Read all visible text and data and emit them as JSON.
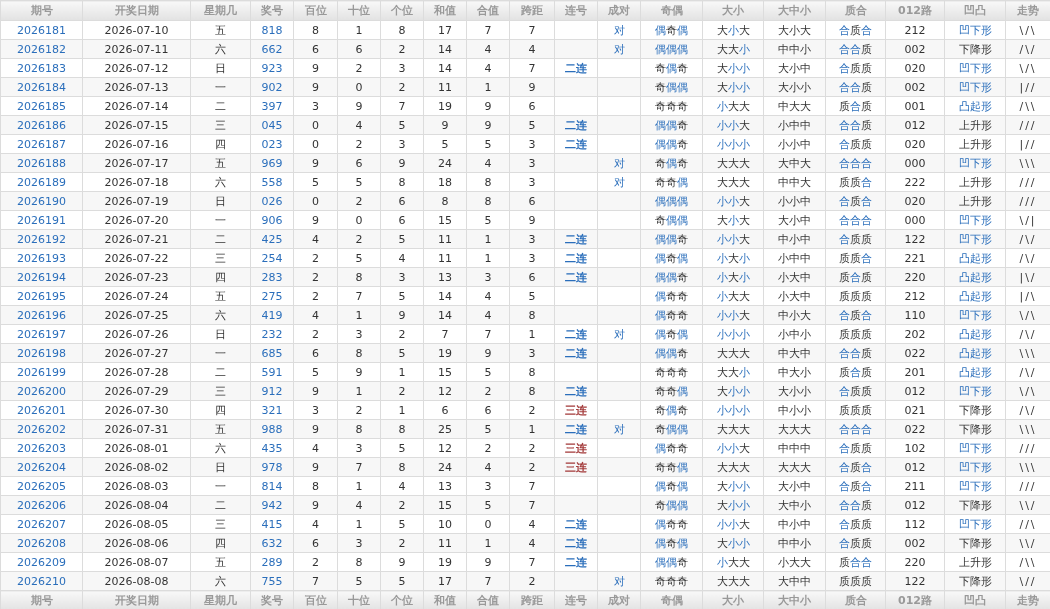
{
  "header": [
    "期号",
    "开奖日期",
    "星期几",
    "奖号",
    "百位",
    "十位",
    "个位",
    "和值",
    "合值",
    "跨距",
    "连号",
    "成对",
    "奇偶",
    "大小",
    "大中小",
    "质合",
    "012路",
    "凹凸",
    "走势"
  ],
  "rows": [
    {
      "issue": "2026181",
      "date": "2026-07-10",
      "weekday": "五",
      "number": "818",
      "hundreds": "8",
      "tens": "1",
      "units": "8",
      "sum": "17",
      "sum_tail": "7",
      "span": "7",
      "pair": "对",
      "parity": "偶奇偶",
      "parity_hl": [
        true,
        false,
        true
      ],
      "size": "大小大",
      "size_hl": [
        false,
        true,
        false
      ],
      "size3": "大小大",
      "prime": "合质合",
      "prime_hl": [
        true,
        false,
        true
      ],
      "route": "212",
      "shape": "凹下形",
      "shape_hl": true,
      "trend": "\\/\\"
    },
    {
      "issue": "2026182",
      "date": "2026-07-11",
      "weekday": "六",
      "number": "662",
      "hundreds": "6",
      "tens": "6",
      "units": "2",
      "sum": "14",
      "sum_tail": "4",
      "span": "4",
      "pair": "对",
      "parity": "偶偶偶",
      "parity_hl": [
        true,
        true,
        true
      ],
      "size": "大大小",
      "size_hl": [
        false,
        false,
        true
      ],
      "size3": "中中小",
      "prime": "合合质",
      "prime_hl": [
        true,
        true,
        false
      ],
      "route": "002",
      "shape": "下降形",
      "shape_hl": false,
      "trend": "/\\/"
    },
    {
      "issue": "2026183",
      "date": "2026-07-12",
      "weekday": "日",
      "number": "923",
      "hundreds": "9",
      "tens": "2",
      "units": "3",
      "sum": "14",
      "sum_tail": "4",
      "span": "7",
      "consec": {
        "text": "二连",
        "color": "#2a6ebb"
      },
      "parity": "奇偶奇",
      "parity_hl": [
        false,
        true,
        false
      ],
      "size": "大小小",
      "size_hl": [
        false,
        true,
        true
      ],
      "size3": "大小中",
      "prime": "合质质",
      "prime_hl": [
        true,
        false,
        false
      ],
      "route": "020",
      "shape": "凹下形",
      "shape_hl": true,
      "trend": "\\/\\"
    },
    {
      "issue": "2026184",
      "date": "2026-07-13",
      "weekday": "一",
      "number": "902",
      "hundreds": "9",
      "tens": "0",
      "units": "2",
      "sum": "11",
      "sum_tail": "1",
      "span": "9",
      "parity": "奇偶偶",
      "parity_hl": [
        false,
        true,
        true
      ],
      "size": "大小小",
      "size_hl": [
        false,
        true,
        true
      ],
      "size3": "大小小",
      "prime": "合合质",
      "prime_hl": [
        true,
        true,
        false
      ],
      "route": "002",
      "shape": "凹下形",
      "shape_hl": true,
      "trend": "|//"
    },
    {
      "issue": "2026185",
      "date": "2026-07-14",
      "weekday": "二",
      "number": "397",
      "hundreds": "3",
      "tens": "9",
      "units": "7",
      "sum": "19",
      "sum_tail": "9",
      "span": "6",
      "parity": "奇奇奇",
      "parity_hl": [
        false,
        false,
        false
      ],
      "size": "小大大",
      "size_hl": [
        true,
        false,
        false
      ],
      "size3": "中大大",
      "prime": "质合质",
      "prime_hl": [
        false,
        true,
        false
      ],
      "route": "001",
      "shape": "凸起形",
      "shape_hl": true,
      "trend": "/\\\\"
    },
    {
      "issue": "2026186",
      "date": "2026-07-15",
      "weekday": "三",
      "number": "045",
      "hundreds": "0",
      "tens": "4",
      "units": "5",
      "sum": "9",
      "sum_tail": "9",
      "span": "5",
      "consec": {
        "text": "二连",
        "color": "#2a6ebb"
      },
      "parity": "偶偶奇",
      "parity_hl": [
        true,
        true,
        false
      ],
      "size": "小小大",
      "size_hl": [
        true,
        true,
        false
      ],
      "size3": "小中中",
      "prime": "合合质",
      "prime_hl": [
        true,
        true,
        false
      ],
      "route": "012",
      "shape": "上升形",
      "shape_hl": false,
      "trend": "///"
    },
    {
      "issue": "2026187",
      "date": "2026-07-16",
      "weekday": "四",
      "number": "023",
      "hundreds": "0",
      "tens": "2",
      "units": "3",
      "sum": "5",
      "sum_tail": "5",
      "span": "3",
      "consec": {
        "text": "二连",
        "color": "#2a6ebb"
      },
      "parity": "偶偶奇",
      "parity_hl": [
        true,
        true,
        false
      ],
      "size": "小小小",
      "size_hl": [
        true,
        true,
        true
      ],
      "size3": "小小中",
      "prime": "合质质",
      "prime_hl": [
        true,
        false,
        false
      ],
      "route": "020",
      "shape": "上升形",
      "shape_hl": false,
      "trend": "|//"
    },
    {
      "issue": "2026188",
      "date": "2026-07-17",
      "weekday": "五",
      "number": "969",
      "hundreds": "9",
      "tens": "6",
      "units": "9",
      "sum": "24",
      "sum_tail": "4",
      "span": "3",
      "pair": "对",
      "parity": "奇偶奇",
      "parity_hl": [
        false,
        true,
        false
      ],
      "size": "大大大",
      "size_hl": [
        false,
        false,
        false
      ],
      "size3": "大中大",
      "prime": "合合合",
      "prime_hl": [
        true,
        true,
        true
      ],
      "route": "000",
      "shape": "凹下形",
      "shape_hl": true,
      "trend": "\\\\\\"
    },
    {
      "issue": "2026189",
      "date": "2026-07-18",
      "weekday": "六",
      "number": "558",
      "hundreds": "5",
      "tens": "5",
      "units": "8",
      "sum": "18",
      "sum_tail": "8",
      "span": "3",
      "pair": "对",
      "parity": "奇奇偶",
      "parity_hl": [
        false,
        false,
        true
      ],
      "size": "大大大",
      "size_hl": [
        false,
        false,
        false
      ],
      "size3": "中中大",
      "prime": "质质合",
      "prime_hl": [
        false,
        false,
        true
      ],
      "route": "222",
      "shape": "上升形",
      "shape_hl": false,
      "trend": "///"
    },
    {
      "issue": "2026190",
      "date": "2026-07-19",
      "weekday": "日",
      "number": "026",
      "hundreds": "0",
      "tens": "2",
      "units": "6",
      "sum": "8",
      "sum_tail": "8",
      "span": "6",
      "parity": "偶偶偶",
      "parity_hl": [
        true,
        true,
        true
      ],
      "size": "小小大",
      "size_hl": [
        true,
        true,
        false
      ],
      "size3": "小小中",
      "prime": "合质合",
      "prime_hl": [
        true,
        false,
        true
      ],
      "route": "020",
      "shape": "上升形",
      "shape_hl": false,
      "trend": "///"
    },
    {
      "issue": "2026191",
      "date": "2026-07-20",
      "weekday": "一",
      "number": "906",
      "hundreds": "9",
      "tens": "0",
      "units": "6",
      "sum": "15",
      "sum_tail": "5",
      "span": "9",
      "parity": "奇偶偶",
      "parity_hl": [
        false,
        true,
        true
      ],
      "size": "大小大",
      "size_hl": [
        false,
        true,
        false
      ],
      "size3": "大小中",
      "prime": "合合合",
      "prime_hl": [
        true,
        true,
        true
      ],
      "route": "000",
      "shape": "凹下形",
      "shape_hl": true,
      "trend": "\\/|"
    },
    {
      "issue": "2026192",
      "date": "2026-07-21",
      "weekday": "二",
      "number": "425",
      "hundreds": "4",
      "tens": "2",
      "units": "5",
      "sum": "11",
      "sum_tail": "1",
      "span": "3",
      "consec": {
        "text": "二连",
        "color": "#2a6ebb"
      },
      "parity": "偶偶奇",
      "parity_hl": [
        true,
        true,
        false
      ],
      "size": "小小大",
      "size_hl": [
        true,
        true,
        false
      ],
      "size3": "中小中",
      "prime": "合质质",
      "prime_hl": [
        true,
        false,
        false
      ],
      "route": "122",
      "shape": "凹下形",
      "shape_hl": true,
      "trend": "/\\/"
    },
    {
      "issue": "2026193",
      "date": "2026-07-22",
      "weekday": "三",
      "number": "254",
      "hundreds": "2",
      "tens": "5",
      "units": "4",
      "sum": "11",
      "sum_tail": "1",
      "span": "3",
      "consec": {
        "text": "二连",
        "color": "#2a6ebb"
      },
      "parity": "偶奇偶",
      "parity_hl": [
        true,
        false,
        true
      ],
      "size": "小大小",
      "size_hl": [
        true,
        false,
        true
      ],
      "size3": "小中中",
      "prime": "质质合",
      "prime_hl": [
        false,
        false,
        true
      ],
      "route": "221",
      "shape": "凸起形",
      "shape_hl": true,
      "trend": "/\\/"
    },
    {
      "issue": "2026194",
      "date": "2026-07-23",
      "weekday": "四",
      "number": "283",
      "hundreds": "2",
      "tens": "8",
      "units": "3",
      "sum": "13",
      "sum_tail": "3",
      "span": "6",
      "consec": {
        "text": "二连",
        "color": "#2a6ebb"
      },
      "parity": "偶偶奇",
      "parity_hl": [
        true,
        true,
        false
      ],
      "size": "小大小",
      "size_hl": [
        true,
        false,
        true
      ],
      "size3": "小大中",
      "prime": "质合质",
      "prime_hl": [
        false,
        true,
        false
      ],
      "route": "220",
      "shape": "凸起形",
      "shape_hl": true,
      "trend": "|\\/"
    },
    {
      "issue": "2026195",
      "date": "2026-07-24",
      "weekday": "五",
      "number": "275",
      "hundreds": "2",
      "tens": "7",
      "units": "5",
      "sum": "14",
      "sum_tail": "4",
      "span": "5",
      "parity": "偶奇奇",
      "parity_hl": [
        true,
        false,
        false
      ],
      "size": "小大大",
      "size_hl": [
        true,
        false,
        false
      ],
      "size3": "小大中",
      "prime": "质质质",
      "prime_hl": [
        false,
        false,
        false
      ],
      "route": "212",
      "shape": "凸起形",
      "shape_hl": true,
      "trend": "|/\\"
    },
    {
      "issue": "2026196",
      "date": "2026-07-25",
      "weekday": "六",
      "number": "419",
      "hundreds": "4",
      "tens": "1",
      "units": "9",
      "sum": "14",
      "sum_tail": "4",
      "span": "8",
      "parity": "偶奇奇",
      "parity_hl": [
        true,
        false,
        false
      ],
      "size": "小小大",
      "size_hl": [
        true,
        true,
        false
      ],
      "size3": "中小大",
      "prime": "合质合",
      "prime_hl": [
        true,
        false,
        true
      ],
      "route": "110",
      "shape": "凹下形",
      "shape_hl": true,
      "trend": "\\/\\"
    },
    {
      "issue": "2026197",
      "date": "2026-07-26",
      "weekday": "日",
      "number": "232",
      "hundreds": "2",
      "tens": "3",
      "units": "2",
      "sum": "7",
      "sum_tail": "7",
      "span": "1",
      "consec": {
        "text": "二连",
        "color": "#2a6ebb"
      },
      "pair": "对",
      "parity": "偶奇偶",
      "parity_hl": [
        true,
        false,
        true
      ],
      "size": "小小小",
      "size_hl": [
        true,
        true,
        true
      ],
      "size3": "小中小",
      "prime": "质质质",
      "prime_hl": [
        false,
        false,
        false
      ],
      "route": "202",
      "shape": "凸起形",
      "shape_hl": true,
      "trend": "/\\/"
    },
    {
      "issue": "2026198",
      "date": "2026-07-27",
      "weekday": "一",
      "number": "685",
      "hundreds": "6",
      "tens": "8",
      "units": "5",
      "sum": "19",
      "sum_tail": "9",
      "span": "3",
      "consec": {
        "text": "二连",
        "color": "#2a6ebb"
      },
      "parity": "偶偶奇",
      "parity_hl": [
        true,
        true,
        false
      ],
      "size": "大大大",
      "size_hl": [
        false,
        false,
        false
      ],
      "size3": "中大中",
      "prime": "合合质",
      "prime_hl": [
        true,
        true,
        false
      ],
      "route": "022",
      "shape": "凸起形",
      "shape_hl": true,
      "trend": "\\\\\\"
    },
    {
      "issue": "2026199",
      "date": "2026-07-28",
      "weekday": "二",
      "number": "591",
      "hundreds": "5",
      "tens": "9",
      "units": "1",
      "sum": "15",
      "sum_tail": "5",
      "span": "8",
      "parity": "奇奇奇",
      "parity_hl": [
        false,
        false,
        false
      ],
      "size": "大大小",
      "size_hl": [
        false,
        false,
        true
      ],
      "size3": "中大小",
      "prime": "质合质",
      "prime_hl": [
        false,
        true,
        false
      ],
      "route": "201",
      "shape": "凸起形",
      "shape_hl": true,
      "trend": "/\\/"
    },
    {
      "issue": "2026200",
      "date": "2026-07-29",
      "weekday": "三",
      "number": "912",
      "hundreds": "9",
      "tens": "1",
      "units": "2",
      "sum": "12",
      "sum_tail": "2",
      "span": "8",
      "consec": {
        "text": "二连",
        "color": "#2a6ebb"
      },
      "parity": "奇奇偶",
      "parity_hl": [
        false,
        false,
        true
      ],
      "size": "大小小",
      "size_hl": [
        false,
        true,
        true
      ],
      "size3": "大小小",
      "prime": "合质质",
      "prime_hl": [
        true,
        false,
        false
      ],
      "route": "012",
      "shape": "凹下形",
      "shape_hl": true,
      "trend": "\\/\\"
    },
    {
      "issue": "2026201",
      "date": "2026-07-30",
      "weekday": "四",
      "number": "321",
      "hundreds": "3",
      "tens": "2",
      "units": "1",
      "sum": "6",
      "sum_tail": "6",
      "span": "2",
      "consec": {
        "text": "三连",
        "color": "#a33a3a"
      },
      "parity": "奇偶奇",
      "parity_hl": [
        false,
        true,
        false
      ],
      "size": "小小小",
      "size_hl": [
        true,
        true,
        true
      ],
      "size3": "中小小",
      "prime": "质质质",
      "prime_hl": [
        false,
        false,
        false
      ],
      "route": "021",
      "shape": "下降形",
      "shape_hl": false,
      "trend": "/\\/"
    },
    {
      "issue": "2026202",
      "date": "2026-07-31",
      "weekday": "五",
      "number": "988",
      "hundreds": "9",
      "tens": "8",
      "units": "8",
      "sum": "25",
      "sum_tail": "5",
      "span": "1",
      "consec": {
        "text": "二连",
        "color": "#2a6ebb"
      },
      "pair": "对",
      "parity": "奇偶偶",
      "parity_hl": [
        false,
        true,
        true
      ],
      "size": "大大大",
      "size_hl": [
        false,
        false,
        false
      ],
      "size3": "大大大",
      "prime": "合合合",
      "prime_hl": [
        true,
        true,
        true
      ],
      "route": "022",
      "shape": "下降形",
      "shape_hl": false,
      "trend": "\\\\\\"
    },
    {
      "issue": "2026203",
      "date": "2026-08-01",
      "weekday": "六",
      "number": "435",
      "hundreds": "4",
      "tens": "3",
      "units": "5",
      "sum": "12",
      "sum_tail": "2",
      "span": "2",
      "consec": {
        "text": "三连",
        "color": "#a33a3a"
      },
      "parity": "偶奇奇",
      "parity_hl": [
        true,
        false,
        false
      ],
      "size": "小小大",
      "size_hl": [
        true,
        true,
        false
      ],
      "size3": "中中中",
      "prime": "合质质",
      "prime_hl": [
        true,
        false,
        false
      ],
      "route": "102",
      "shape": "凹下形",
      "shape_hl": true,
      "trend": "///"
    },
    {
      "issue": "2026204",
      "date": "2026-08-02",
      "weekday": "日",
      "number": "978",
      "hundreds": "9",
      "tens": "7",
      "units": "8",
      "sum": "24",
      "sum_tail": "4",
      "span": "2",
      "consec": {
        "text": "三连",
        "color": "#a33a3a"
      },
      "parity": "奇奇偶",
      "parity_hl": [
        false,
        false,
        true
      ],
      "size": "大大大",
      "size_hl": [
        false,
        false,
        false
      ],
      "size3": "大大大",
      "prime": "合质合",
      "prime_hl": [
        true,
        false,
        true
      ],
      "route": "012",
      "shape": "凹下形",
      "shape_hl": true,
      "trend": "\\\\\\"
    },
    {
      "issue": "2026205",
      "date": "2026-08-03",
      "weekday": "一",
      "number": "814",
      "hundreds": "8",
      "tens": "1",
      "units": "4",
      "sum": "13",
      "sum_tail": "3",
      "span": "7",
      "parity": "偶奇偶",
      "parity_hl": [
        true,
        false,
        true
      ],
      "size": "大小小",
      "size_hl": [
        false,
        true,
        true
      ],
      "size3": "大小中",
      "prime": "合质合",
      "prime_hl": [
        true,
        false,
        true
      ],
      "route": "211",
      "shape": "凹下形",
      "shape_hl": true,
      "trend": "///"
    },
    {
      "issue": "2026206",
      "date": "2026-08-04",
      "weekday": "二",
      "number": "942",
      "hundreds": "9",
      "tens": "4",
      "units": "2",
      "sum": "15",
      "sum_tail": "5",
      "span": "7",
      "parity": "奇偶偶",
      "parity_hl": [
        false,
        true,
        true
      ],
      "size": "大小小",
      "size_hl": [
        false,
        true,
        true
      ],
      "size3": "大中小",
      "prime": "合合质",
      "prime_hl": [
        true,
        true,
        false
      ],
      "route": "012",
      "shape": "下降形",
      "shape_hl": false,
      "trend": "\\\\/"
    },
    {
      "issue": "2026207",
      "date": "2026-08-05",
      "weekday": "三",
      "number": "415",
      "hundreds": "4",
      "tens": "1",
      "units": "5",
      "sum": "10",
      "sum_tail": "0",
      "span": "4",
      "consec": {
        "text": "二连",
        "color": "#2a6ebb"
      },
      "parity": "偶奇奇",
      "parity_hl": [
        true,
        false,
        false
      ],
      "size": "小小大",
      "size_hl": [
        true,
        true,
        false
      ],
      "size3": "中小中",
      "prime": "合质质",
      "prime_hl": [
        true,
        false,
        false
      ],
      "route": "112",
      "shape": "凹下形",
      "shape_hl": true,
      "trend": "//\\"
    },
    {
      "issue": "2026208",
      "date": "2026-08-06",
      "weekday": "四",
      "number": "632",
      "hundreds": "6",
      "tens": "3",
      "units": "2",
      "sum": "11",
      "sum_tail": "1",
      "span": "4",
      "consec": {
        "text": "二连",
        "color": "#2a6ebb"
      },
      "parity": "偶奇偶",
      "parity_hl": [
        true,
        false,
        true
      ],
      "size": "大小小",
      "size_hl": [
        false,
        true,
        true
      ],
      "size3": "中中小",
      "prime": "合质质",
      "prime_hl": [
        true,
        false,
        false
      ],
      "route": "002",
      "shape": "下降形",
      "shape_hl": false,
      "trend": "\\\\/"
    },
    {
      "issue": "2026209",
      "date": "2026-08-07",
      "weekday": "五",
      "number": "289",
      "hundreds": "2",
      "tens": "8",
      "units": "9",
      "sum": "19",
      "sum_tail": "9",
      "span": "7",
      "consec": {
        "text": "二连",
        "color": "#2a6ebb"
      },
      "parity": "偶偶奇",
      "parity_hl": [
        true,
        true,
        false
      ],
      "size": "小大大",
      "size_hl": [
        true,
        false,
        false
      ],
      "size3": "小大大",
      "prime": "质合合",
      "prime_hl": [
        false,
        true,
        true
      ],
      "route": "220",
      "shape": "上升形",
      "shape_hl": false,
      "trend": "/\\\\"
    },
    {
      "issue": "2026210",
      "date": "2026-08-08",
      "weekday": "六",
      "number": "755",
      "hundreds": "7",
      "tens": "5",
      "units": "5",
      "sum": "17",
      "sum_tail": "7",
      "span": "2",
      "pair": "对",
      "parity": "奇奇奇",
      "parity_hl": [
        false,
        false,
        false
      ],
      "size": "大大大",
      "size_hl": [
        false,
        false,
        false
      ],
      "size3": "大中中",
      "prime": "质质质",
      "prime_hl": [
        false,
        false,
        false
      ],
      "route": "122",
      "shape": "下降形",
      "shape_hl": false,
      "trend": "\\//"
    }
  ],
  "footer": [
    "期号",
    "开奖日期",
    "星期几",
    "奖号",
    "百位",
    "十位",
    "个位",
    "和值",
    "合值",
    "跨距",
    "连号",
    "成对",
    "奇偶",
    "大小",
    "大中小",
    "质合",
    "012路",
    "凹凸",
    "走势"
  ]
}
